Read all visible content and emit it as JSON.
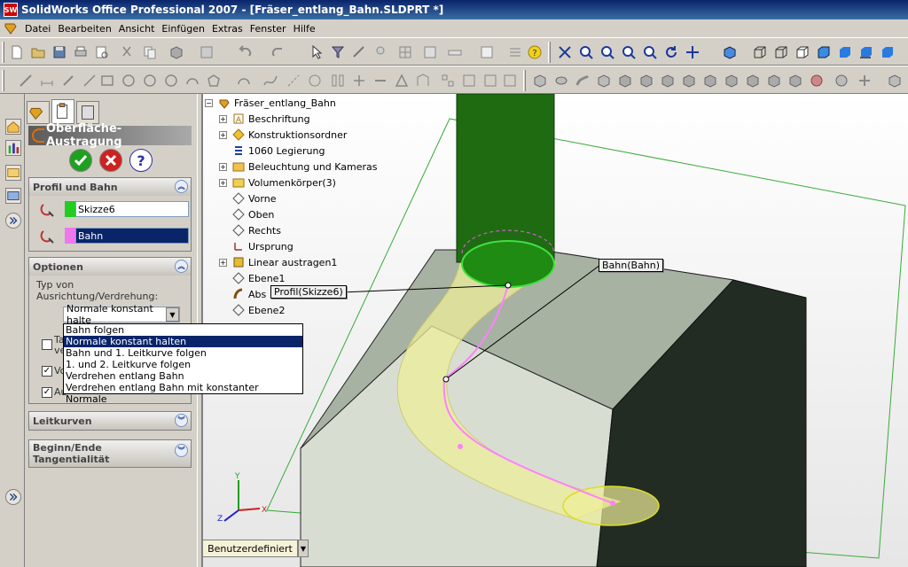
{
  "window": {
    "title": "SolidWorks Office Professional 2007 - [Fräser_entlang_Bahn.SLDPRT *]",
    "logo_text": "SW"
  },
  "menu": [
    "Datei",
    "Bearbeiten",
    "Ansicht",
    "Einfügen",
    "Extras",
    "Fenster",
    "Hilfe"
  ],
  "property_manager": {
    "title": "Oberfläche-Austragung",
    "profil_bahn": {
      "header": "Profil und Bahn",
      "profile_value": "Skizze6",
      "path_value": "Bahn",
      "profile_color": "#22cc22",
      "path_color": "#ee77ee"
    },
    "optionen": {
      "header": "Optionen",
      "label_line1": "Typ von",
      "label_line2": "Ausrichtung/Verdrehung:",
      "selected": "Normale konstant halte",
      "options": [
        "Bahn folgen",
        "Normale konstant halten",
        "Bahn und 1. Leitkurve folgen",
        "1. und 2. Leitkurve folgen",
        "Verdrehen entlang Bahn",
        "Verdrehen entlang Bahn mit konstanter Normale"
      ],
      "highlighted_index": 1,
      "check1_partial": "Ta",
      "check1_partial2": "ve",
      "check2_partial": "Vo",
      "check3_partial": "Au"
    },
    "leitkurven": {
      "header": "Leitkurven"
    },
    "tangential": {
      "header_line1": "Beginn/Ende",
      "header_line2": "Tangentialität"
    }
  },
  "tree": {
    "root": "Fräser_entlang_Bahn",
    "items": [
      {
        "label": "Beschriftung",
        "expand": "+"
      },
      {
        "label": "Konstruktionsordner",
        "expand": "+"
      },
      {
        "label": "1060 Legierung",
        "expand": ""
      },
      {
        "label": "Beleuchtung und Kameras",
        "expand": "+"
      },
      {
        "label": "Volumenkörper(3)",
        "expand": "+"
      },
      {
        "label": "Vorne",
        "expand": ""
      },
      {
        "label": "Oben",
        "expand": ""
      },
      {
        "label": "Rechts",
        "expand": ""
      },
      {
        "label": "Ursprung",
        "expand": ""
      },
      {
        "label": "Linear austragen1",
        "expand": "+"
      },
      {
        "label": "Ebene1",
        "expand": ""
      },
      {
        "label": "Abs",
        "expand": ""
      },
      {
        "label": "Ebene2",
        "expand": ""
      }
    ]
  },
  "callouts": {
    "path": "Bahn(Bahn)",
    "profile": "Profil(Skizze6)"
  },
  "status": {
    "view": "Benutzerdefiniert"
  },
  "triad": {
    "x": "X",
    "y": "Y",
    "z": "Z"
  },
  "colors": {
    "titlebar": "#0a246a",
    "tool": "#1f6b12",
    "block": "#a0aa9a",
    "sweep": "#eeee99"
  }
}
